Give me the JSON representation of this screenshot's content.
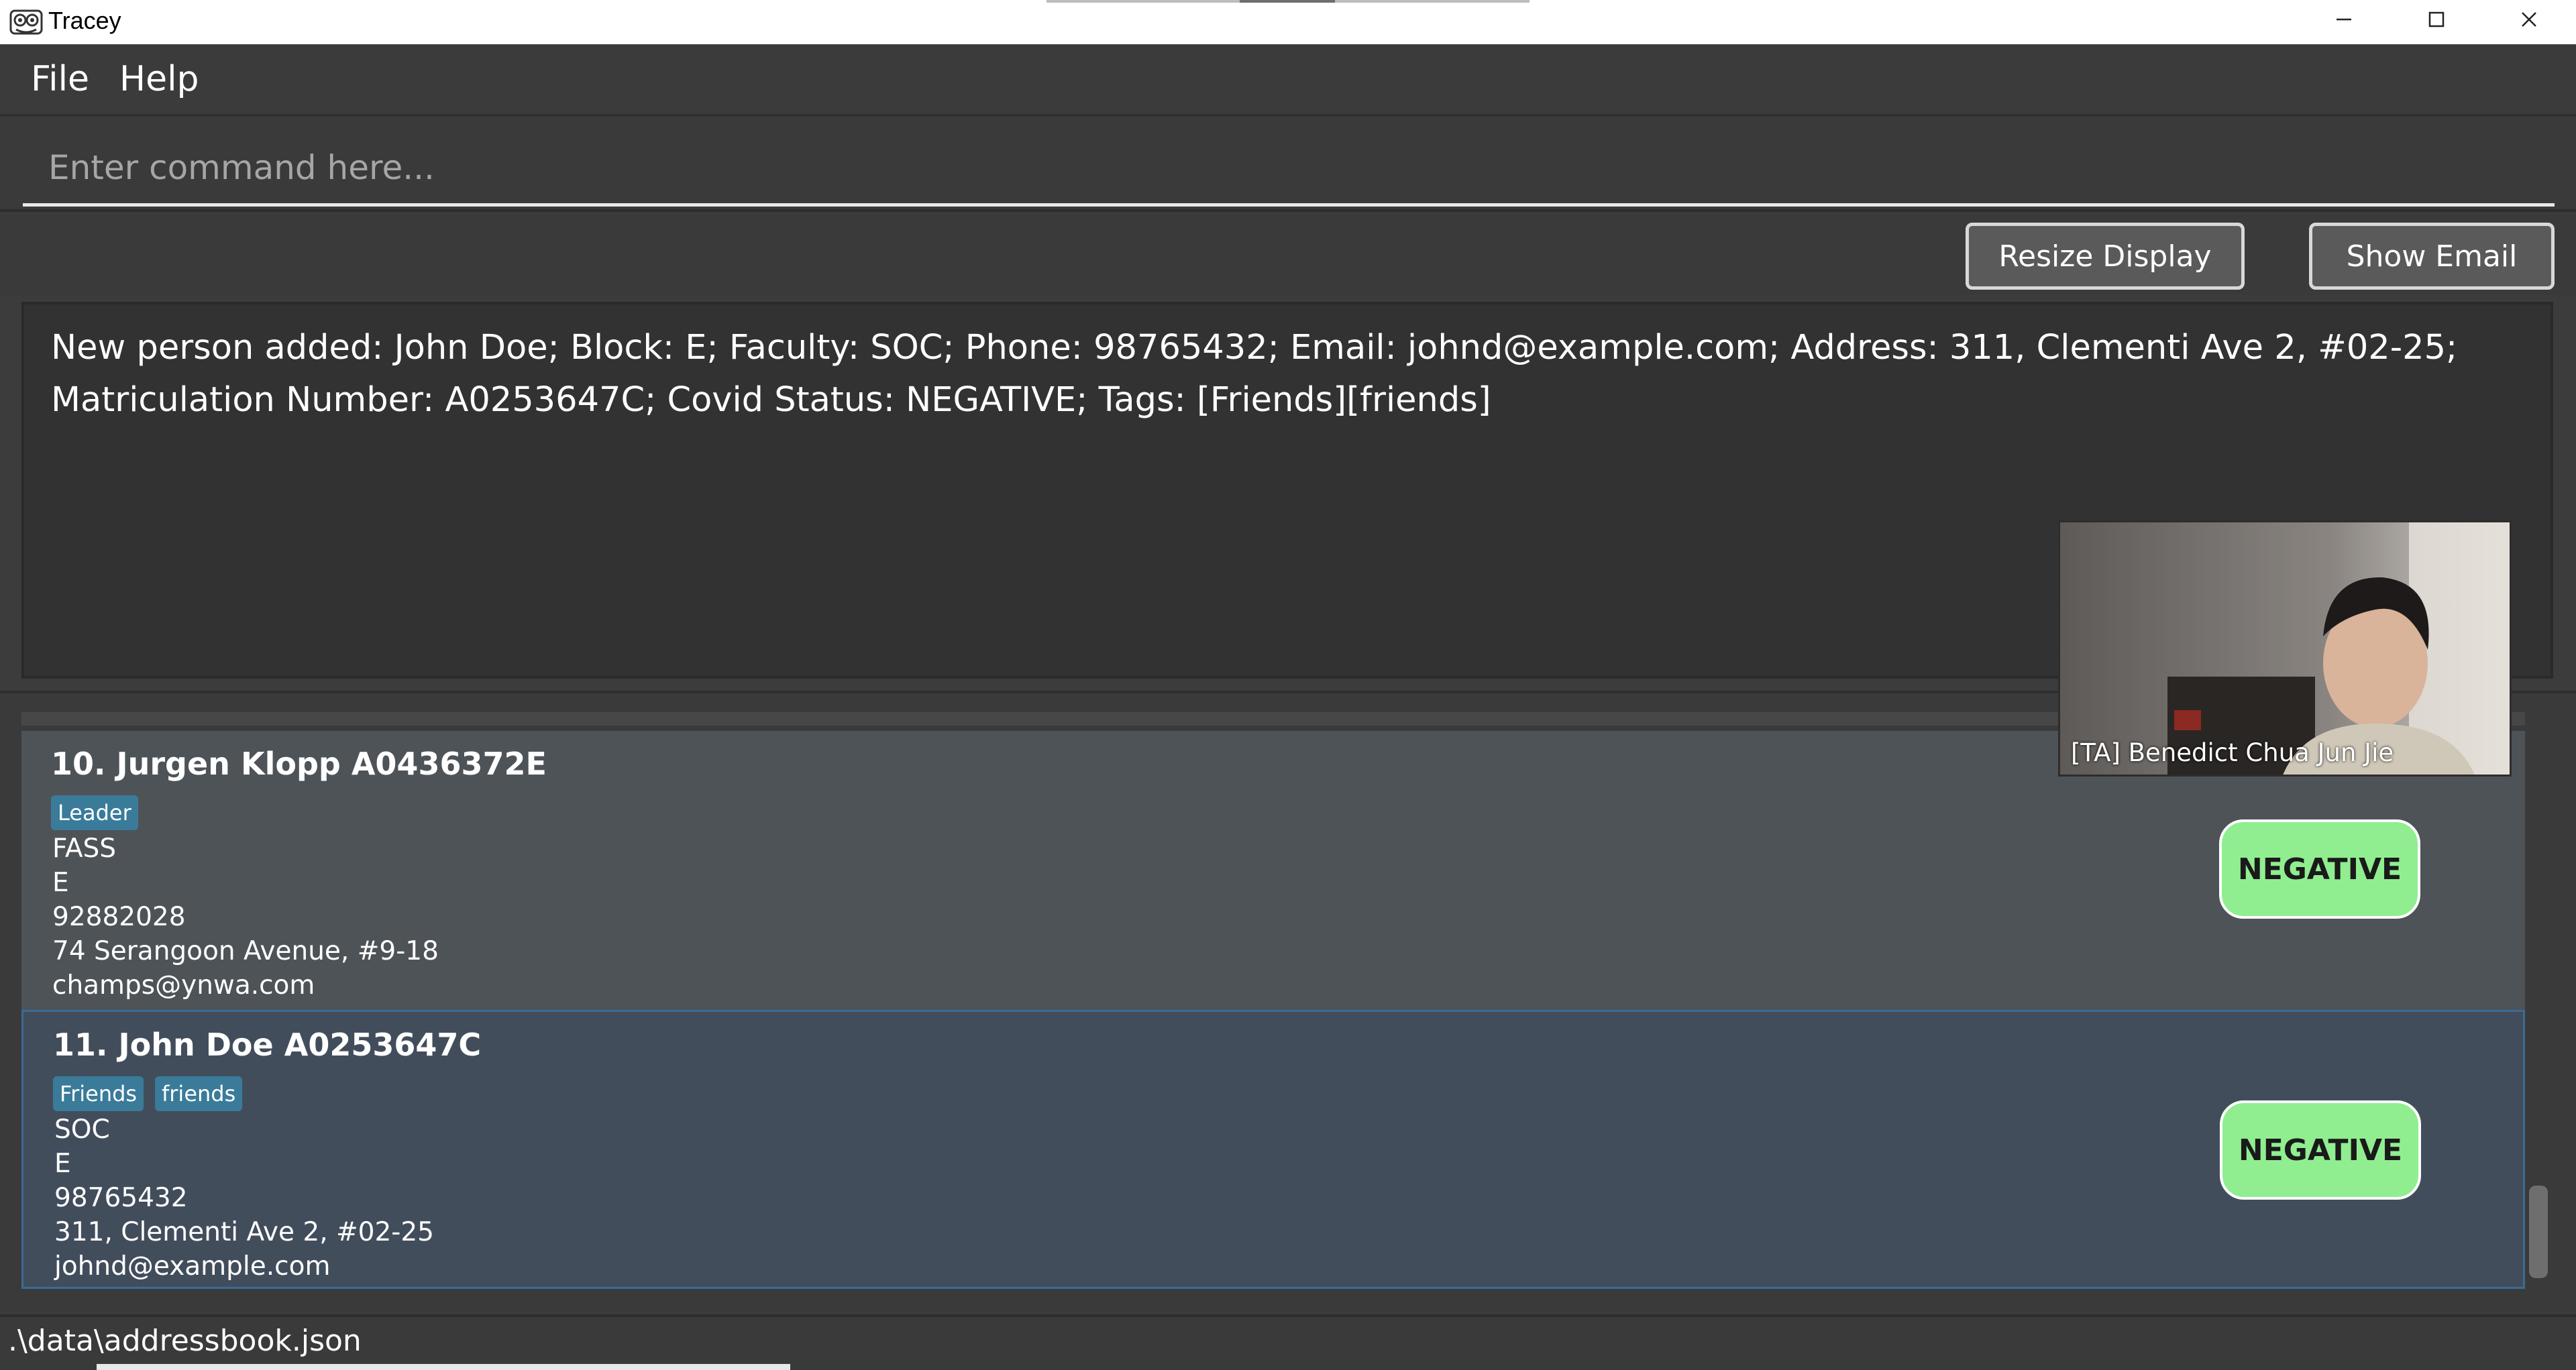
{
  "window": {
    "title": "Tracey",
    "controls": {
      "minimize": "minimize-icon",
      "maximize": "maximize-icon",
      "close": "close-icon"
    }
  },
  "menu": {
    "file": "File",
    "help": "Help"
  },
  "command": {
    "placeholder": "Enter command here...",
    "value": ""
  },
  "buttons": {
    "resize": "Resize Display",
    "show_email": "Show Email"
  },
  "result": {
    "text": "New person added: John Doe; Block: E; Faculty: SOC; Phone: 98765432; Email: johnd@example.com; Address: 311, Clementi Ave 2, #02-25; Matriculation Number: A0253647C; Covid Status: NEGATIVE; Tags: [Friends][friends]"
  },
  "persons": [
    {
      "index": "10.",
      "title": "10.  Jurgen Klopp A0436372E",
      "tags": [
        "Leader"
      ],
      "faculty": "FASS",
      "block": "E",
      "phone": "92882028",
      "address": "74 Serangoon Avenue, #9-18",
      "email": "champs@ynwa.com",
      "status": "NEGATIVE"
    },
    {
      "index": "11.",
      "title": "11.  John Doe A0253647C",
      "tags": [
        "Friends",
        "friends"
      ],
      "faculty": "SOC",
      "block": "E",
      "phone": "98765432",
      "address": "311, Clementi Ave 2, #02-25",
      "email": "johnd@example.com",
      "status": "NEGATIVE"
    }
  ],
  "status_bar": {
    "path": ".\\data\\addressbook.json"
  },
  "video": {
    "participant": "[TA] Benedict Chua Jun Jie"
  },
  "colors": {
    "background": "#3c3c3c",
    "tag": "#3a7b9a",
    "status_negative": "#90ee90",
    "selected_card": "#424d5c"
  }
}
